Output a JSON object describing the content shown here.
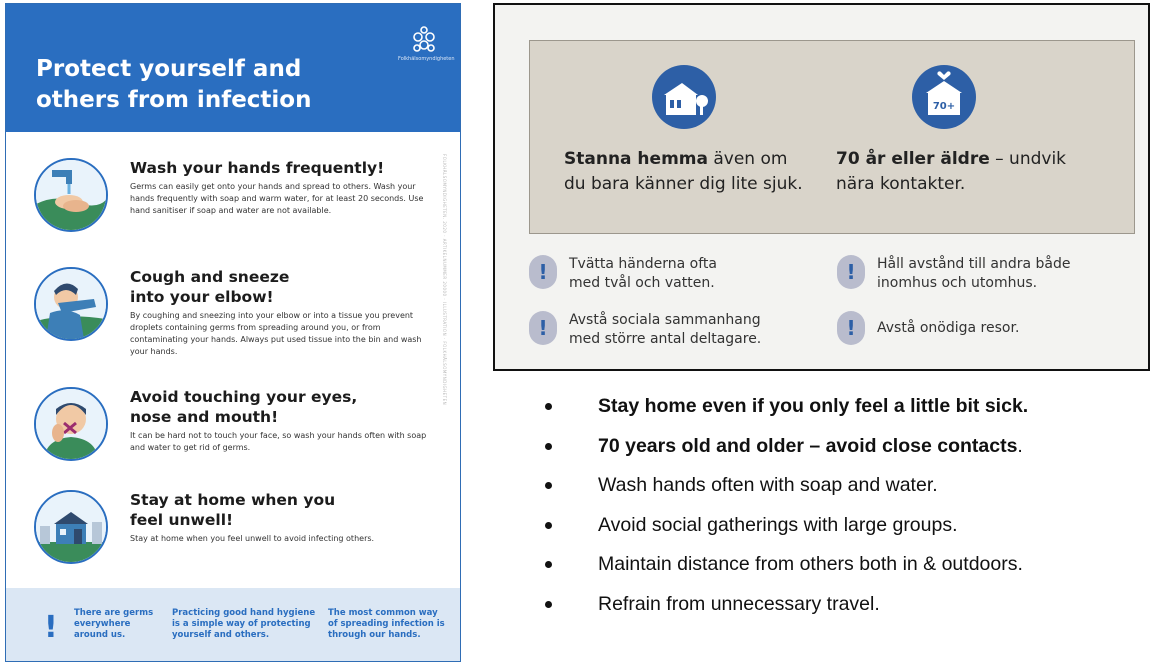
{
  "poster": {
    "title_line1": "Protect yourself and",
    "title_line2": "others from infection",
    "agency_name": "Folkhälsomyndigheten",
    "side_code": "FOLKHÄLSOMYNDIGHETEN. 2020 · ARTIKELNUMMER 20000 · ILLUSTRATION · FOLKHÄLSOMYNDIGHETEN",
    "tips": [
      {
        "title": "Wash your hands frequently!",
        "body": "Germs can easily get onto your hands and spread to others. Wash your hands frequently with soap and warm water, for at least 20 seconds. Use hand sanitiser if soap and water are not available."
      },
      {
        "title_line1": "Cough and sneeze",
        "title_line2": "into your elbow!",
        "body": "By coughing and sneezing into your elbow or into a tissue you prevent droplets containing germs from spreading around you, or from contaminating your hands. Always put used tissue into the bin and wash your hands."
      },
      {
        "title_line1": "Avoid touching your eyes,",
        "title_line2": "nose and mouth!",
        "body": "It can be hard not to touch your face, so wash your hands often with soap and water to get rid of germs."
      },
      {
        "title_line1": "Stay at home when you",
        "title_line2": "feel unwell!",
        "body": "Stay at home when you feel unwell to avoid infecting others."
      }
    ],
    "footer": {
      "mark": "!",
      "col1": [
        "There are germs",
        "everywhere",
        "around us."
      ],
      "col2": [
        "Practicing good hand hygiene",
        "is a simple way of protecting",
        "yourself and others."
      ],
      "col3": [
        "The most common way",
        "of spreading infection is",
        "through our hands."
      ]
    }
  },
  "panel": {
    "item1": {
      "bold": "Stanna hemma",
      "rest_line1": " även om",
      "line2": "du bara känner dig lite sjuk."
    },
    "item2": {
      "bold": "70 år eller äldre",
      "rest_line1": " – undvik",
      "line2": "nära  kontakter.",
      "icon_label": "70+"
    },
    "alerts": [
      {
        "line1": "Tvätta händerna ofta",
        "line2": "med tvål och vatten."
      },
      {
        "line1": "Håll avstånd till andra både",
        "line2": "inomhus och utomhus."
      },
      {
        "line1": "Avstå sociala sammanhang",
        "line2": "med större antal deltagare."
      },
      {
        "line1": "Avstå onödiga resor.",
        "line2": ""
      }
    ],
    "alert_mark": "!"
  },
  "bullets": [
    {
      "text": "Stay home even if you only feel a little bit sick.",
      "bold": true
    },
    {
      "bold_text": "70 years old and older – avoid close contacts",
      "rest": "."
    },
    {
      "text": "Wash hands often with soap and water.",
      "bold": false
    },
    {
      "text": "Avoid social gatherings with large groups.",
      "bold": false
    },
    {
      "text": "Maintain distance from others both in & outdoors.",
      "bold": false
    },
    {
      "text": "Refrain from unnecessary travel.",
      "bold": false
    }
  ],
  "colors": {
    "poster_blue": "#2a6ec0",
    "footer_bg": "#dbe7f4",
    "panel_box": "#d9d4ca",
    "icon_blue": "#2d5fa6"
  }
}
